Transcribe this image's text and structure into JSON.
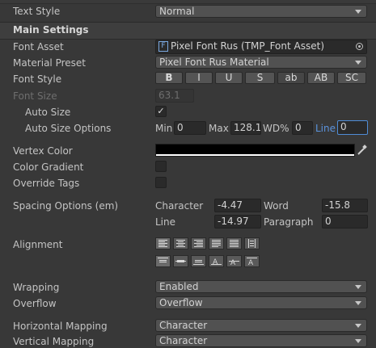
{
  "top": {
    "text_style_label": "Text Style",
    "text_style_value": "Normal"
  },
  "main_settings": {
    "header": "Main Settings",
    "font_asset_label": "Font Asset",
    "font_asset_value": "Pixel Font Rus (TMP_Font Asset)",
    "material_preset_label": "Material Preset",
    "material_preset_value": "Pixel Font Rus Material",
    "font_style_label": "Font Style",
    "font_style_buttons": [
      "B",
      "I",
      "U",
      "S",
      "ab",
      "AB",
      "SC"
    ],
    "font_size_label": "Font Size",
    "font_size_value": "63.1",
    "auto_size_label": "Auto Size",
    "auto_size_checked": true,
    "auto_size_check_glyph": "✓",
    "auto_size_options_label": "Auto Size Options",
    "min_label": "Min",
    "min_value": "0",
    "max_label": "Max",
    "max_value": "128.1",
    "wd_label": "WD%",
    "wd_value": "0",
    "line_label": "Line",
    "line_value": "0",
    "vertex_color_label": "Vertex Color",
    "vertex_color_hex": "#000000",
    "color_gradient_label": "Color Gradient",
    "override_tags_label": "Override Tags",
    "spacing_label": "Spacing Options (em)",
    "character_label": "Character",
    "character_value": "-4.47",
    "word_label": "Word",
    "word_value": "-15.8",
    "line_sp_label": "Line",
    "line_sp_value": "-14.97",
    "paragraph_label": "Paragraph",
    "paragraph_value": "0",
    "alignment_label": "Alignment",
    "horizontal_alignment_icons": [
      "align-left-icon",
      "align-center-icon",
      "align-right-icon",
      "align-justified-icon",
      "align-flush-icon",
      "align-geometry-center-icon"
    ],
    "vertical_alignment_icons": [
      "align-top-icon",
      "align-middle-icon",
      "align-bottom-icon",
      "align-baseline-icon",
      "align-midline-icon",
      "align-capline-icon"
    ],
    "wrapping_label": "Wrapping",
    "wrapping_value": "Enabled",
    "overflow_label": "Overflow",
    "overflow_value": "Overflow",
    "horizontal_mapping_label": "Horizontal Mapping",
    "horizontal_mapping_value": "Character",
    "vertical_mapping_label": "Vertical Mapping",
    "vertical_mapping_value": "Character"
  },
  "colors": {
    "panel_bg": "#383838",
    "header_bg": "#3e3e3e",
    "accent": "#4f8cd6"
  }
}
